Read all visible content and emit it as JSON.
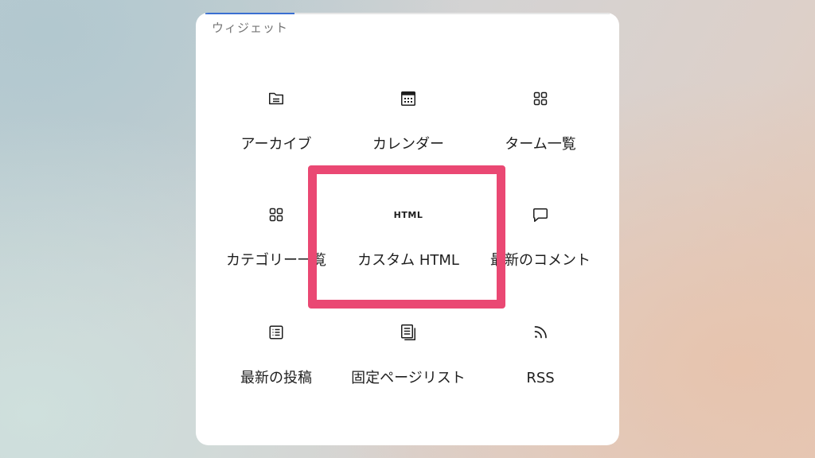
{
  "panel": {
    "section_title": "ウィジェット"
  },
  "widgets": [
    {
      "label": "アーカイブ",
      "icon": "archive-folder-icon"
    },
    {
      "label": "カレンダー",
      "icon": "calendar-icon"
    },
    {
      "label": "ターム一覧",
      "icon": "grid-icon"
    },
    {
      "label": "カテゴリー一覧",
      "icon": "grid-icon"
    },
    {
      "label": "カスタム HTML",
      "icon": "html-icon",
      "icon_text": "HTML"
    },
    {
      "label": "最新のコメント",
      "icon": "comment-icon"
    },
    {
      "label": "最新の投稿",
      "icon": "post-list-icon"
    },
    {
      "label": "固定ページリスト",
      "icon": "pages-icon"
    },
    {
      "label": "RSS",
      "icon": "rss-icon"
    }
  ],
  "colors": {
    "highlight": "#ea4873",
    "scroll_thumb": "#3a6fd1",
    "text": "#1e1e1e"
  }
}
